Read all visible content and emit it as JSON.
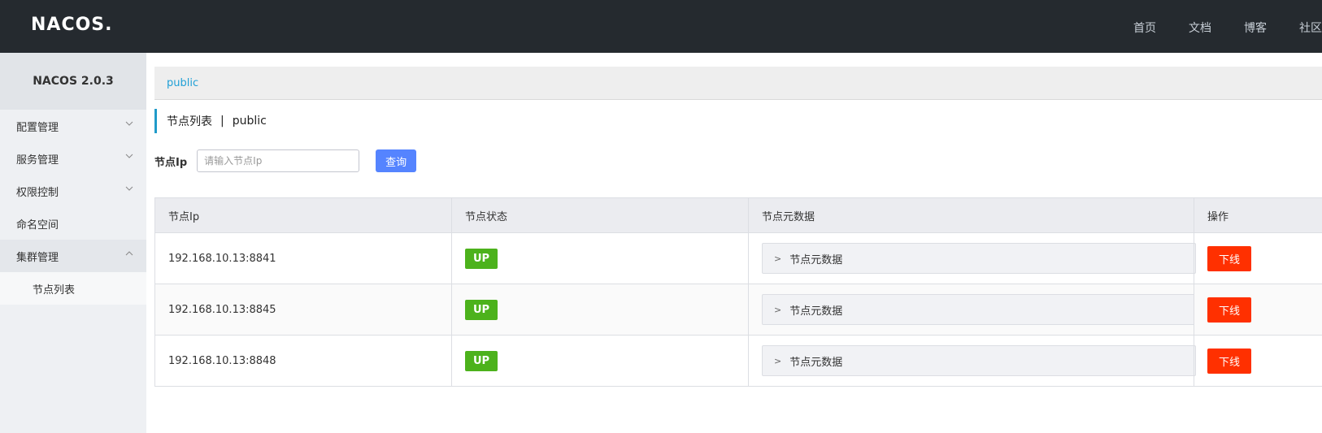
{
  "header": {
    "logo": "NACOS.",
    "nav": [
      "首页",
      "文档",
      "博客",
      "社区"
    ]
  },
  "sidebar": {
    "title": "NACOS 2.0.3",
    "items": [
      {
        "label": "配置管理"
      },
      {
        "label": "服务管理"
      },
      {
        "label": "权限控制"
      },
      {
        "label": "命名空间"
      },
      {
        "label": "集群管理"
      }
    ],
    "sub_items": [
      {
        "label": "节点列表"
      }
    ]
  },
  "namespace": {
    "current": "public"
  },
  "page": {
    "title": "节点列表",
    "separator": "|",
    "namespace": "public"
  },
  "search": {
    "label": "节点Ip",
    "placeholder": "请输入节点Ip",
    "button": "查询"
  },
  "table": {
    "headers": [
      "节点Ip",
      "节点状态",
      "节点元数据",
      "操作"
    ],
    "rows": [
      {
        "ip": "192.168.10.13:8841",
        "status": "UP",
        "meta": "节点元数据",
        "action": "下线"
      },
      {
        "ip": "192.168.10.13:8845",
        "status": "UP",
        "meta": "节点元数据",
        "action": "下线"
      },
      {
        "ip": "192.168.10.13:8848",
        "status": "UP",
        "meta": "节点元数据",
        "action": "下线"
      }
    ]
  },
  "colors": {
    "header_bg": "#252a2f",
    "accent": "#209bc9",
    "primary_button": "#5584ff",
    "status_up": "#4cb21c",
    "danger": "#ff3000"
  },
  "icons": {
    "menu_arrow": "chevron-down-icon",
    "menu_arrow_open": "chevron-up-icon",
    "expand": "chevron-right-icon"
  }
}
